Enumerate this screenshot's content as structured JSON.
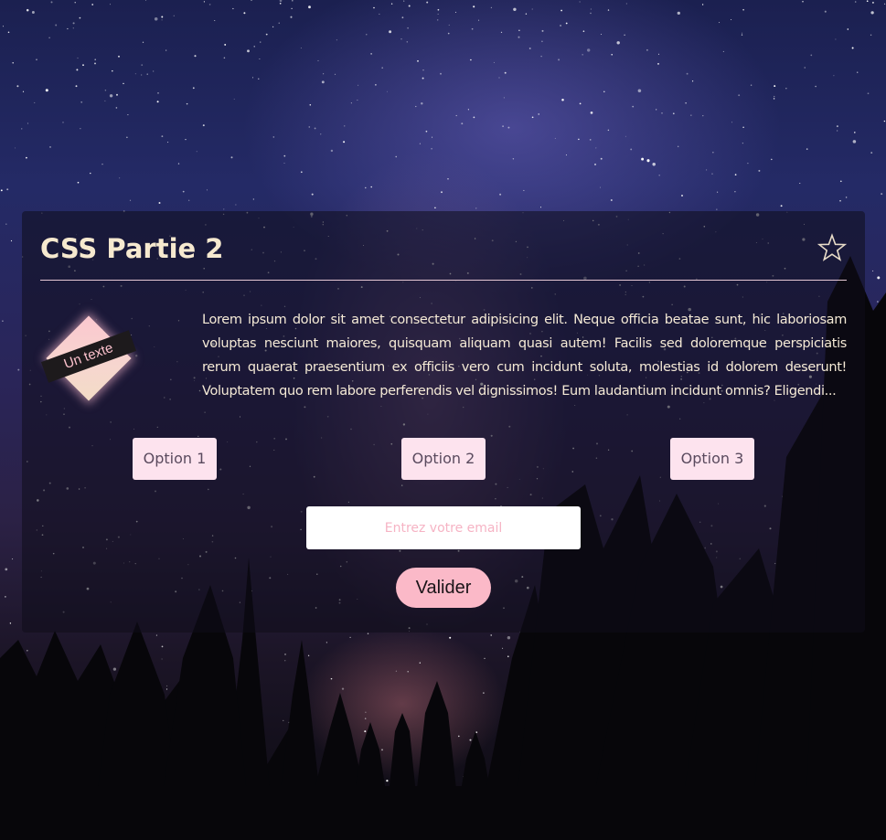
{
  "card": {
    "title": "CSS Partie 2",
    "favorite_icon": "star-outline-icon",
    "badge_text": "Un texte",
    "body_text": "Lorem ipsum dolor sit amet consectetur adipisicing elit. Neque officia beatae sunt, hic laboriosam voluptas nesciunt maiores, quisquam aliquam quasi autem! Facilis sed doloremque perspiciatis rerum quaerat praesentium ex officiis vero cum incidunt soluta, molestias id dolorem deserunt! Voluptatem quo rem labore perferendis vel dignissimos! Eum laudantium incidunt omnis? Eligendi...",
    "options": [
      "Option 1",
      "Option 2",
      "Option 3"
    ],
    "email_placeholder": "Entrez votre email",
    "email_value": "",
    "submit_label": "Valider"
  },
  "colors": {
    "title": "#f6e9cf",
    "accent_pink": "#fbb9c8",
    "option_bg": "#fde3ee",
    "divider": "#e6c8d4"
  }
}
